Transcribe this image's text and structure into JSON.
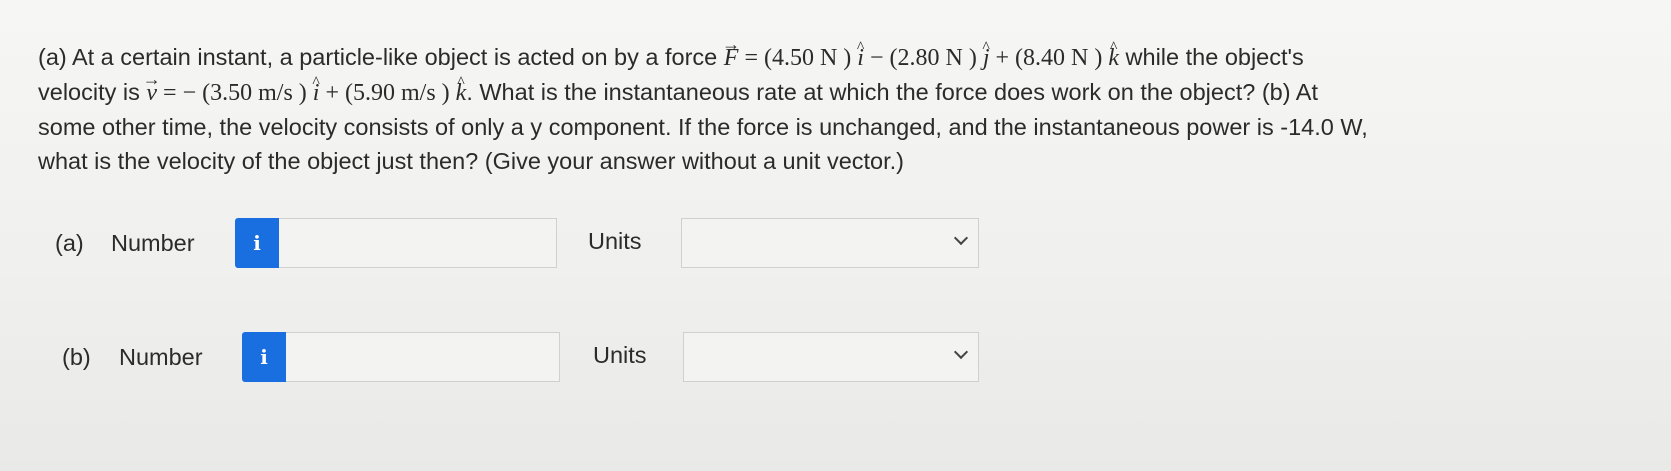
{
  "question": {
    "line1_intro": "(a) At a certain instant, a particle-like object is acted on by a force ",
    "force_symbol": "F",
    "force_eq": " = (4.50 N ) ",
    "force_mid1": " − (2.80 N ) ",
    "force_mid2": " + (8.40 N ) ",
    "line1_tail": " while the object's",
    "line2_intro": "velocity is ",
    "velocity_symbol": "v",
    "velocity_eq": " = − (3.50 m/s ) ",
    "velocity_mid": " + (5.90 m/s ) ",
    "line2_tail": ". What is the instantaneous rate at which the force does work on the object? (b) At",
    "line3": "some other time, the velocity consists of only a y component. If the force is unchanged, and the instantaneous power is -14.0 W,",
    "line4": "what is the velocity of the object just then? (Give your answer without a unit vector.)",
    "unit_i": "i",
    "unit_j": "j",
    "unit_k": "k"
  },
  "part_a": {
    "label": "(a)",
    "number_label": "Number",
    "info_icon": "i",
    "number_value": "",
    "units_label": "Units",
    "units_selected": ""
  },
  "part_b": {
    "label": "(b)",
    "number_label": "Number",
    "info_icon": "i",
    "number_value": "",
    "units_label": "Units",
    "units_selected": ""
  },
  "colors": {
    "info_button": "#1a6fe0",
    "background": "#f2f2f0",
    "text": "#2b2b2b"
  },
  "icons": {
    "info": "info-icon",
    "dropdown": "chevron-down-icon"
  }
}
